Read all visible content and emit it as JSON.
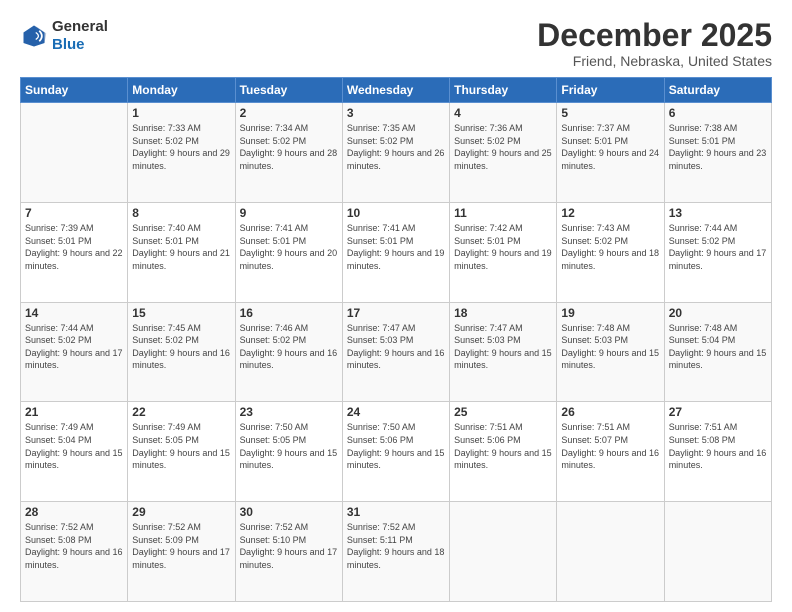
{
  "header": {
    "logo_line1": "General",
    "logo_line2": "Blue",
    "month_title": "December 2025",
    "location": "Friend, Nebraska, United States"
  },
  "days_of_week": [
    "Sunday",
    "Monday",
    "Tuesday",
    "Wednesday",
    "Thursday",
    "Friday",
    "Saturday"
  ],
  "weeks": [
    [
      {
        "num": "",
        "sunrise": "",
        "sunset": "",
        "daylight": ""
      },
      {
        "num": "1",
        "sunrise": "Sunrise: 7:33 AM",
        "sunset": "Sunset: 5:02 PM",
        "daylight": "Daylight: 9 hours and 29 minutes."
      },
      {
        "num": "2",
        "sunrise": "Sunrise: 7:34 AM",
        "sunset": "Sunset: 5:02 PM",
        "daylight": "Daylight: 9 hours and 28 minutes."
      },
      {
        "num": "3",
        "sunrise": "Sunrise: 7:35 AM",
        "sunset": "Sunset: 5:02 PM",
        "daylight": "Daylight: 9 hours and 26 minutes."
      },
      {
        "num": "4",
        "sunrise": "Sunrise: 7:36 AM",
        "sunset": "Sunset: 5:02 PM",
        "daylight": "Daylight: 9 hours and 25 minutes."
      },
      {
        "num": "5",
        "sunrise": "Sunrise: 7:37 AM",
        "sunset": "Sunset: 5:01 PM",
        "daylight": "Daylight: 9 hours and 24 minutes."
      },
      {
        "num": "6",
        "sunrise": "Sunrise: 7:38 AM",
        "sunset": "Sunset: 5:01 PM",
        "daylight": "Daylight: 9 hours and 23 minutes."
      }
    ],
    [
      {
        "num": "7",
        "sunrise": "Sunrise: 7:39 AM",
        "sunset": "Sunset: 5:01 PM",
        "daylight": "Daylight: 9 hours and 22 minutes."
      },
      {
        "num": "8",
        "sunrise": "Sunrise: 7:40 AM",
        "sunset": "Sunset: 5:01 PM",
        "daylight": "Daylight: 9 hours and 21 minutes."
      },
      {
        "num": "9",
        "sunrise": "Sunrise: 7:41 AM",
        "sunset": "Sunset: 5:01 PM",
        "daylight": "Daylight: 9 hours and 20 minutes."
      },
      {
        "num": "10",
        "sunrise": "Sunrise: 7:41 AM",
        "sunset": "Sunset: 5:01 PM",
        "daylight": "Daylight: 9 hours and 19 minutes."
      },
      {
        "num": "11",
        "sunrise": "Sunrise: 7:42 AM",
        "sunset": "Sunset: 5:01 PM",
        "daylight": "Daylight: 9 hours and 19 minutes."
      },
      {
        "num": "12",
        "sunrise": "Sunrise: 7:43 AM",
        "sunset": "Sunset: 5:02 PM",
        "daylight": "Daylight: 9 hours and 18 minutes."
      },
      {
        "num": "13",
        "sunrise": "Sunrise: 7:44 AM",
        "sunset": "Sunset: 5:02 PM",
        "daylight": "Daylight: 9 hours and 17 minutes."
      }
    ],
    [
      {
        "num": "14",
        "sunrise": "Sunrise: 7:44 AM",
        "sunset": "Sunset: 5:02 PM",
        "daylight": "Daylight: 9 hours and 17 minutes."
      },
      {
        "num": "15",
        "sunrise": "Sunrise: 7:45 AM",
        "sunset": "Sunset: 5:02 PM",
        "daylight": "Daylight: 9 hours and 16 minutes."
      },
      {
        "num": "16",
        "sunrise": "Sunrise: 7:46 AM",
        "sunset": "Sunset: 5:02 PM",
        "daylight": "Daylight: 9 hours and 16 minutes."
      },
      {
        "num": "17",
        "sunrise": "Sunrise: 7:47 AM",
        "sunset": "Sunset: 5:03 PM",
        "daylight": "Daylight: 9 hours and 16 minutes."
      },
      {
        "num": "18",
        "sunrise": "Sunrise: 7:47 AM",
        "sunset": "Sunset: 5:03 PM",
        "daylight": "Daylight: 9 hours and 15 minutes."
      },
      {
        "num": "19",
        "sunrise": "Sunrise: 7:48 AM",
        "sunset": "Sunset: 5:03 PM",
        "daylight": "Daylight: 9 hours and 15 minutes."
      },
      {
        "num": "20",
        "sunrise": "Sunrise: 7:48 AM",
        "sunset": "Sunset: 5:04 PM",
        "daylight": "Daylight: 9 hours and 15 minutes."
      }
    ],
    [
      {
        "num": "21",
        "sunrise": "Sunrise: 7:49 AM",
        "sunset": "Sunset: 5:04 PM",
        "daylight": "Daylight: 9 hours and 15 minutes."
      },
      {
        "num": "22",
        "sunrise": "Sunrise: 7:49 AM",
        "sunset": "Sunset: 5:05 PM",
        "daylight": "Daylight: 9 hours and 15 minutes."
      },
      {
        "num": "23",
        "sunrise": "Sunrise: 7:50 AM",
        "sunset": "Sunset: 5:05 PM",
        "daylight": "Daylight: 9 hours and 15 minutes."
      },
      {
        "num": "24",
        "sunrise": "Sunrise: 7:50 AM",
        "sunset": "Sunset: 5:06 PM",
        "daylight": "Daylight: 9 hours and 15 minutes."
      },
      {
        "num": "25",
        "sunrise": "Sunrise: 7:51 AM",
        "sunset": "Sunset: 5:06 PM",
        "daylight": "Daylight: 9 hours and 15 minutes."
      },
      {
        "num": "26",
        "sunrise": "Sunrise: 7:51 AM",
        "sunset": "Sunset: 5:07 PM",
        "daylight": "Daylight: 9 hours and 16 minutes."
      },
      {
        "num": "27",
        "sunrise": "Sunrise: 7:51 AM",
        "sunset": "Sunset: 5:08 PM",
        "daylight": "Daylight: 9 hours and 16 minutes."
      }
    ],
    [
      {
        "num": "28",
        "sunrise": "Sunrise: 7:52 AM",
        "sunset": "Sunset: 5:08 PM",
        "daylight": "Daylight: 9 hours and 16 minutes."
      },
      {
        "num": "29",
        "sunrise": "Sunrise: 7:52 AM",
        "sunset": "Sunset: 5:09 PM",
        "daylight": "Daylight: 9 hours and 17 minutes."
      },
      {
        "num": "30",
        "sunrise": "Sunrise: 7:52 AM",
        "sunset": "Sunset: 5:10 PM",
        "daylight": "Daylight: 9 hours and 17 minutes."
      },
      {
        "num": "31",
        "sunrise": "Sunrise: 7:52 AM",
        "sunset": "Sunset: 5:11 PM",
        "daylight": "Daylight: 9 hours and 18 minutes."
      },
      {
        "num": "",
        "sunrise": "",
        "sunset": "",
        "daylight": ""
      },
      {
        "num": "",
        "sunrise": "",
        "sunset": "",
        "daylight": ""
      },
      {
        "num": "",
        "sunrise": "",
        "sunset": "",
        "daylight": ""
      }
    ]
  ]
}
